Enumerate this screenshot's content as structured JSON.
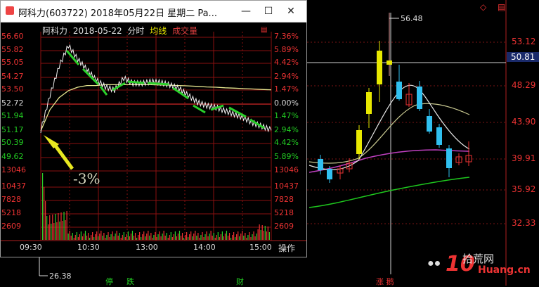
{
  "window": {
    "title": "阿科力(603722) 2018年05月22日 星期二 Pa...",
    "minimize_icon": "minimize-icon",
    "maximize_icon": "maximize-icon",
    "close_icon": "close-icon"
  },
  "intraday_header": {
    "name": "阿科力",
    "date": "2018-05-22",
    "mode": "分时",
    "avg_label": "均线",
    "vol_label": "成交量",
    "colors": {
      "name": "#e0e0e0",
      "date": "#e0e0e0",
      "mode": "#e0e0e0",
      "avg_label": "#e8e800",
      "vol_label": "#e04040"
    }
  },
  "intraday_price_ticks": [
    "56.60",
    "55.82",
    "55.05",
    "54.27",
    "53.50",
    "52.72",
    "51.94",
    "51.17",
    "50.39",
    "49.62"
  ],
  "intraday_pct_ticks": [
    "7.36%",
    "5.89%",
    "4.42%",
    "2.94%",
    "1.47%",
    "0.00%",
    "1.47%",
    "2.94%",
    "4.42%",
    "5.89%"
  ],
  "intraday_pct_colors": [
    "#e33",
    "#e33",
    "#e33",
    "#e33",
    "#e33",
    "#ddd",
    "#2c2",
    "#2c2",
    "#2c2",
    "#2c2"
  ],
  "intraday_price_colors": [
    "#e33",
    "#e33",
    "#e33",
    "#e33",
    "#e33",
    "#ddd",
    "#2c2",
    "#2c2",
    "#2c2",
    "#2c2"
  ],
  "volume_ticks": [
    "13046",
    "10437",
    "7828",
    "5218",
    "2609"
  ],
  "time_ticks": [
    "09:30",
    "10:30",
    "13:00",
    "14:00",
    "15:00"
  ],
  "operate_label": "操作",
  "annotation": "-3%",
  "kline": {
    "price_ticks": [
      "53.12",
      "50.81",
      "48.29",
      "43.90",
      "39.91",
      "35.92",
      "32.33"
    ],
    "highlight_price": "50.81",
    "peak_label": "56.48",
    "low_label": "26.38",
    "bottom_labels": [
      {
        "text": "停",
        "color": "#2c2"
      },
      {
        "text": "跌",
        "color": "#2c2"
      },
      {
        "text": "财",
        "color": "#2c2"
      },
      {
        "text": "涨 鹅",
        "color": "#e33"
      }
    ]
  },
  "watermark": {
    "number": "10",
    "site_name": "拾荒网",
    "url": "Huang.cn",
    "icon": "wechat-icon"
  },
  "chart_data": {
    "type": "line",
    "title": "阿科力 2018-05-22 分时",
    "series": [
      {
        "name": "price",
        "x": [
          "09:30",
          "09:35",
          "09:40",
          "09:45",
          "09:50",
          "10:00",
          "10:10",
          "10:20",
          "10:30",
          "10:40",
          "10:50",
          "11:00",
          "11:10",
          "11:20",
          "11:30",
          "13:00",
          "13:15",
          "13:30",
          "13:45",
          "14:00",
          "14:10",
          "14:20",
          "14:30",
          "14:40",
          "14:50",
          "15:00"
        ],
        "y": [
          51.17,
          53.2,
          54.9,
          56.1,
          55.3,
          54.7,
          54.1,
          53.7,
          53.5,
          54.2,
          53.9,
          53.9,
          54.0,
          53.95,
          53.8,
          53.6,
          53.2,
          52.8,
          52.6,
          52.5,
          52.3,
          52.1,
          51.9,
          51.6,
          51.4,
          51.2
        ]
      },
      {
        "name": "均线",
        "y": [
          51.17,
          52.4,
          53.1,
          53.5,
          53.7,
          53.8,
          53.8,
          53.85,
          53.85,
          53.85,
          53.85,
          53.85,
          53.85,
          53.83,
          53.82,
          53.8,
          53.78,
          53.75,
          53.72,
          53.7,
          53.67,
          53.65,
          53.62,
          53.6,
          53.57,
          53.55
        ]
      }
    ],
    "ylim": [
      49.62,
      56.6
    ],
    "volume_ylim": [
      0,
      13046
    ]
  }
}
